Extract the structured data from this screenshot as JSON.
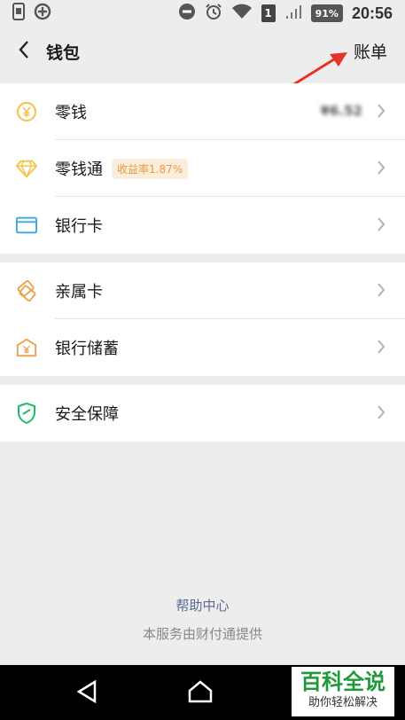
{
  "status_bar": {
    "time": "20:56",
    "battery": "91%",
    "sim_slot": "1"
  },
  "header": {
    "back_icon": "chevron-left-icon",
    "title": "钱包",
    "bill_label": "账单"
  },
  "group1": [
    {
      "label": "零钱",
      "icon": "yen-coin-icon",
      "balance": "¥6.52"
    },
    {
      "label": "零钱通",
      "icon": "diamond-icon",
      "badge": "收益率1.87%"
    },
    {
      "label": "银行卡",
      "icon": "bank-card-icon"
    }
  ],
  "group2": [
    {
      "label": "亲属卡",
      "icon": "family-card-icon"
    },
    {
      "label": "银行储蓄",
      "icon": "bank-savings-icon"
    }
  ],
  "group3": [
    {
      "label": "安全保障",
      "icon": "shield-icon"
    }
  ],
  "footer": {
    "help": "帮助中心",
    "provider": "本服务由财付通提供"
  },
  "watermark": {
    "big": "百科全说",
    "small": "助你轻松解决"
  },
  "colors": {
    "accent_link": "#576b95",
    "coin_yellow": "#f5c342",
    "bank_blue": "#3ba6e0",
    "orange": "#eba04a",
    "shield_green": "#1fbb6b",
    "arrow_red": "#e5332a"
  }
}
